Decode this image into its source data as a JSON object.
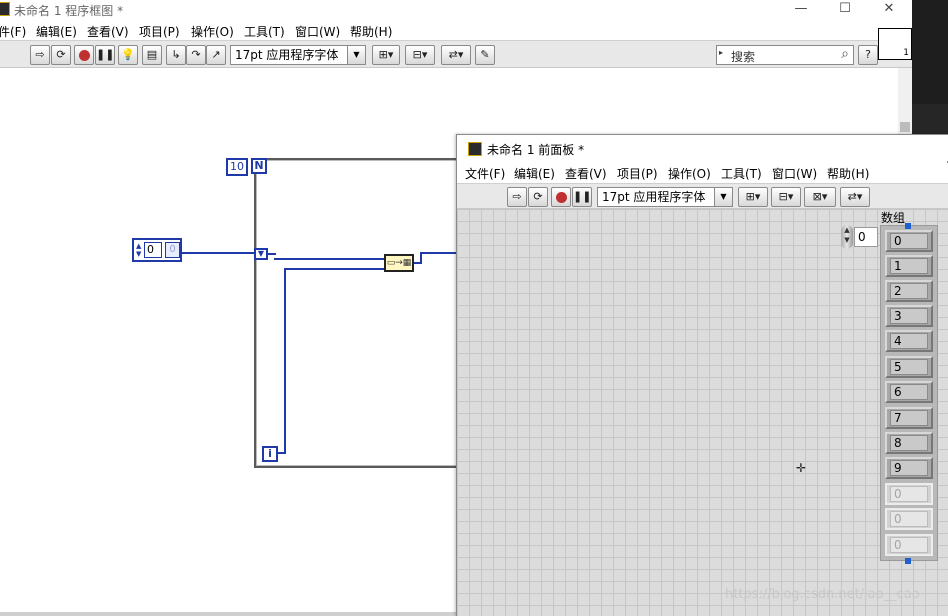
{
  "block_diagram": {
    "title": "未命名 1 程序框图 *",
    "window_controls": {
      "minimize": "—",
      "maximize": "☐",
      "close": "✕"
    },
    "menu": [
      "件(F)",
      "编辑(E)",
      "查看(V)",
      "项目(P)",
      "操作(O)",
      "工具(T)",
      "窗口(W)",
      "帮助(H)"
    ],
    "font_select": "17pt 应用程序字体",
    "search_placeholder": "搜索",
    "help_label": "?",
    "connector_label": "1",
    "loop_count": "10",
    "loop_N": "N",
    "loop_i": "i",
    "control_value": "0",
    "control_terminal": "0"
  },
  "front_panel": {
    "title": "未命名 1 前面板 *",
    "menu": [
      "文件(F)",
      "编辑(E)",
      "查看(V)",
      "项目(P)",
      "操作(O)",
      "工具(T)",
      "窗口(W)",
      "帮助(H)"
    ],
    "font_select": "17pt 应用程序字体",
    "array": {
      "label": "数组",
      "index": "0",
      "elements": [
        {
          "value": "0",
          "dim": false
        },
        {
          "value": "1",
          "dim": false
        },
        {
          "value": "2",
          "dim": false
        },
        {
          "value": "3",
          "dim": false
        },
        {
          "value": "4",
          "dim": false
        },
        {
          "value": "5",
          "dim": false
        },
        {
          "value": "6",
          "dim": false
        },
        {
          "value": "7",
          "dim": false
        },
        {
          "value": "8",
          "dim": false
        },
        {
          "value": "9",
          "dim": false
        },
        {
          "value": "0",
          "dim": true
        },
        {
          "value": "0",
          "dim": true
        },
        {
          "value": "0",
          "dim": true
        }
      ]
    }
  },
  "watermark": "https://blog.csdn.net/lao__cao",
  "colors": {
    "wire_blue": "#1f3aa8",
    "grid_bg": "#dcdcdc",
    "selection_blue": "#1f5fd0"
  }
}
